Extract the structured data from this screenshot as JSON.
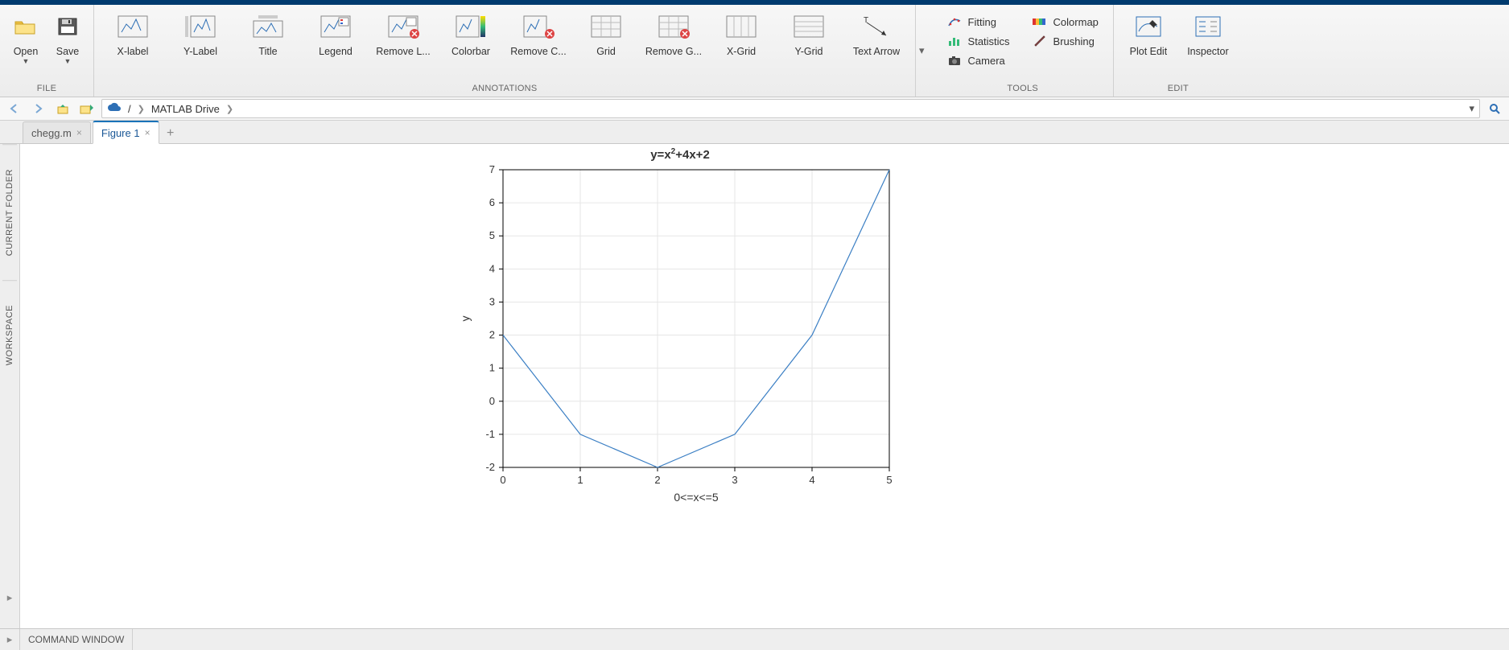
{
  "file_group": {
    "caption": "FILE",
    "open": "Open",
    "save": "Save"
  },
  "annotations_group": {
    "caption": "ANNOTATIONS",
    "items": [
      {
        "id": "xlabel",
        "label": "X-label"
      },
      {
        "id": "ylabel",
        "label": "Y-Label"
      },
      {
        "id": "title",
        "label": "Title"
      },
      {
        "id": "legend",
        "label": "Legend"
      },
      {
        "id": "remove-legend",
        "label": "Remove L..."
      },
      {
        "id": "colorbar",
        "label": "Colorbar"
      },
      {
        "id": "remove-colorbar",
        "label": "Remove C..."
      },
      {
        "id": "grid",
        "label": "Grid"
      },
      {
        "id": "remove-grid",
        "label": "Remove G..."
      },
      {
        "id": "xgrid",
        "label": "X-Grid"
      },
      {
        "id": "ygrid",
        "label": "Y-Grid"
      },
      {
        "id": "text-arrow",
        "label": "Text Arrow"
      }
    ]
  },
  "tools_group": {
    "caption": "TOOLS",
    "fitting": "Fitting",
    "statistics": "Statistics",
    "camera": "Camera",
    "colormap": "Colormap",
    "brushing": "Brushing"
  },
  "edit_group": {
    "caption": "EDIT",
    "plot_edit": "Plot Edit",
    "inspector": "Inspector"
  },
  "path": {
    "drive": "MATLAB Drive"
  },
  "tabs": {
    "t0": "chegg.m",
    "t1": "Figure 1"
  },
  "side": {
    "folder": "CURRENT FOLDER",
    "workspace": "WORKSPACE"
  },
  "cmd": {
    "title": "COMMAND WINDOW"
  },
  "chart_data": {
    "type": "line",
    "title": "y=x²+4x+2",
    "title_html": "y=x<sup>2</sup>+4x+2",
    "xlabel": "0<=x<=5",
    "ylabel": "y",
    "x": [
      0,
      1,
      2,
      3,
      4,
      5
    ],
    "y": [
      2,
      -1,
      -2,
      -1,
      2,
      7
    ],
    "xlim": [
      0,
      5
    ],
    "ylim": [
      -2,
      7
    ],
    "xticks": [
      0,
      1,
      2,
      3,
      4,
      5
    ],
    "yticks": [
      -2,
      -1,
      0,
      1,
      2,
      3,
      4,
      5,
      6,
      7
    ]
  }
}
